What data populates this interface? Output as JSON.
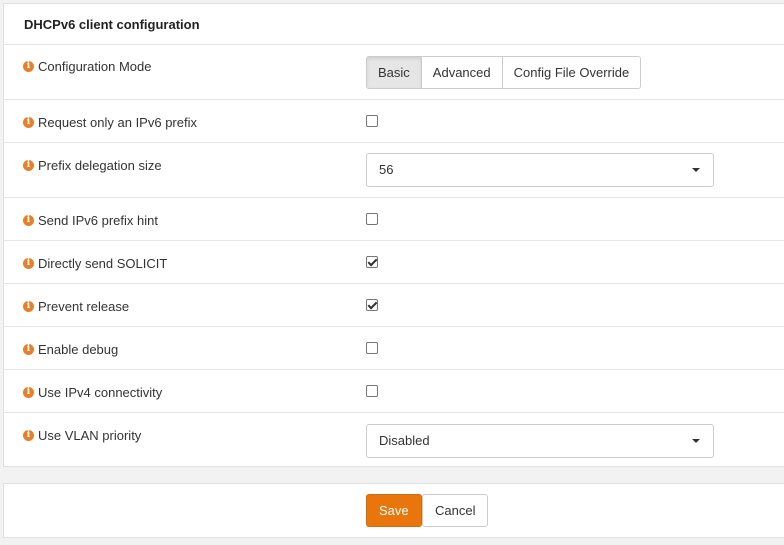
{
  "panel": {
    "title": "DHCPv6 client configuration"
  },
  "rows": {
    "config_mode": {
      "label": "Configuration Mode",
      "options": [
        "Basic",
        "Advanced",
        "Config File Override"
      ],
      "selected": "Basic"
    },
    "request_prefix": {
      "label": "Request only an IPv6 prefix",
      "checked": false
    },
    "prefix_delegation": {
      "label": "Prefix delegation size",
      "value": "56"
    },
    "send_hint": {
      "label": "Send IPv6 prefix hint",
      "checked": false
    },
    "send_solicit": {
      "label": "Directly send SOLICIT",
      "checked": true
    },
    "prevent_release": {
      "label": "Prevent release",
      "checked": true
    },
    "enable_debug": {
      "label": "Enable debug",
      "checked": false
    },
    "use_ipv4": {
      "label": "Use IPv4 connectivity",
      "checked": false
    },
    "vlan_priority": {
      "label": "Use VLAN priority",
      "value": "Disabled"
    }
  },
  "footer": {
    "save_label": "Save",
    "cancel_label": "Cancel"
  },
  "colors": {
    "accent": "#e8760c",
    "info_icon": "#e87f2a"
  },
  "icons": {
    "info": "info-icon",
    "select_caret": "caret-down-icon",
    "checkmark": "checkmark-icon"
  }
}
